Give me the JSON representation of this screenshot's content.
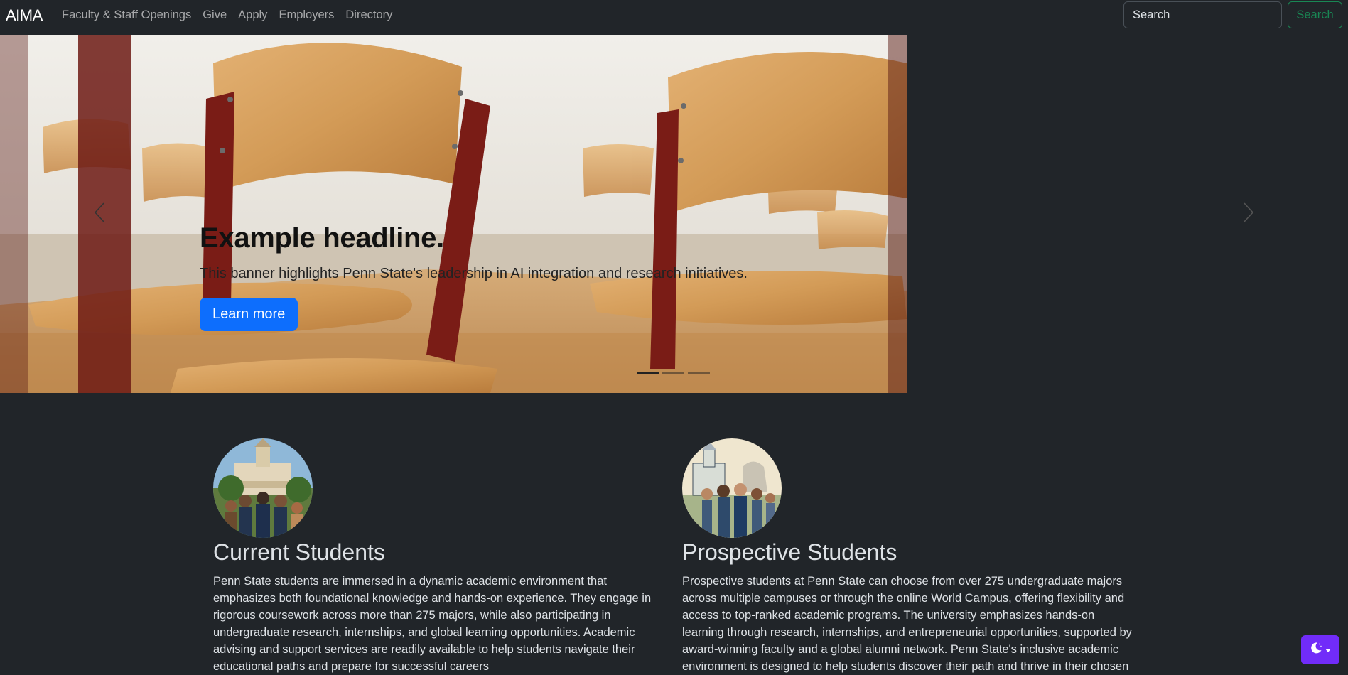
{
  "navbar": {
    "brand": "AIMA",
    "links": [
      "Faculty & Staff Openings",
      "Give",
      "Apply",
      "Employers",
      "Directory"
    ],
    "search_placeholder": "Search",
    "search_button": "Search"
  },
  "carousel": {
    "headline": "Example headline.",
    "text": "This banner highlights Penn State's leadership in AI integration and research initiatives.",
    "button": "Learn more",
    "active_index": 0,
    "slide_count": 3
  },
  "columns": [
    {
      "title": "Current Students",
      "text": "Penn State students are immersed in a dynamic academic environment that emphasizes both foundational knowledge and hands-on experience. They engage in rigorous coursework across more than 275 majors, while also participating in undergraduate research, internships, and global learning opportunities. Academic advising and support services are readily available to help students navigate their educational paths and prepare for successful careers"
    },
    {
      "title": "Prospective Students",
      "text": "Prospective students at Penn State can choose from over 275 undergraduate majors across multiple campuses or through the online World Campus, offering flexibility and access to top-ranked academic programs. The university emphasizes hands-on learning through research, internships, and entrepreneurial opportunities, supported by award-winning faculty and a global alumni network. Penn State's inclusive academic environment is designed to help students discover their path and thrive in their chosen"
    }
  ],
  "colors": {
    "background": "#212529",
    "primary": "#0d6efd",
    "success": "#198754",
    "theme_toggle": "#712cf9"
  },
  "icons": {
    "carousel_prev": "chevron-left-icon",
    "carousel_next": "chevron-right-icon",
    "theme_toggle": "moon-icon"
  }
}
